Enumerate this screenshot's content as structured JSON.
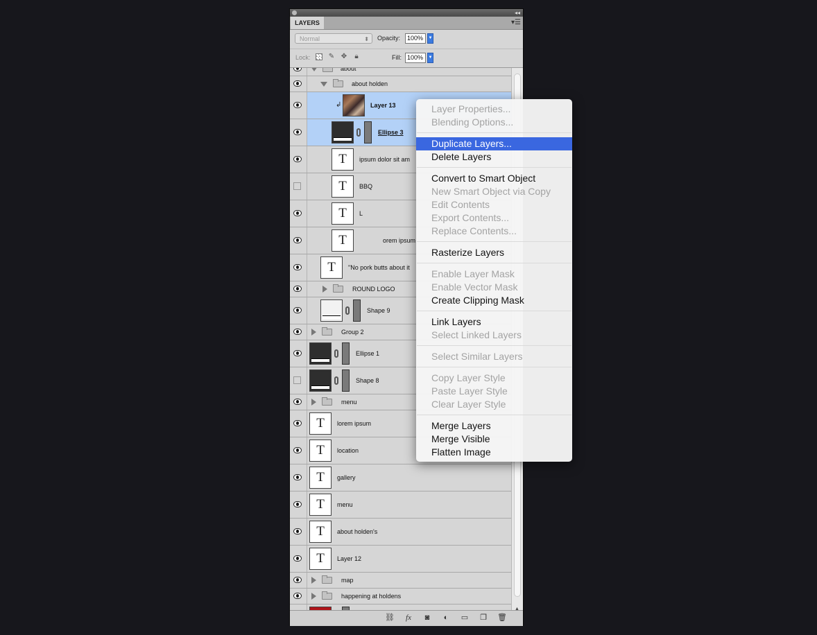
{
  "panel": {
    "tab_label": "LAYERS",
    "blend_mode": "Normal",
    "opacity_label": "Opacity:",
    "opacity_value": "100%",
    "lock_label": "Lock:",
    "fill_label": "Fill:",
    "fill_value": "100%"
  },
  "layers": [
    {
      "name": "about",
      "kind": "group-open",
      "visible": true
    },
    {
      "name": "about holden",
      "kind": "group-open",
      "visible": true
    },
    {
      "name": "Layer 13",
      "kind": "image-clipped",
      "visible": true,
      "selected": true
    },
    {
      "name": "Ellipse 3",
      "kind": "shape",
      "visible": true,
      "selected": true
    },
    {
      "name": "ipsum dolor sit am",
      "kind": "text",
      "visible": true
    },
    {
      "name": "BBQ",
      "kind": "text",
      "visible": false
    },
    {
      "name": "L",
      "kind": "text",
      "visible": true
    },
    {
      "name": "orem ipsum",
      "kind": "text",
      "visible": true
    },
    {
      "name": "\"No pork butts about it",
      "kind": "text",
      "visible": true
    },
    {
      "name": "ROUND LOGO",
      "kind": "group-closed",
      "visible": true
    },
    {
      "name": "Shape 9",
      "kind": "shape-light",
      "visible": true
    },
    {
      "name": "Group 2",
      "kind": "group-closed",
      "visible": true
    },
    {
      "name": "Ellipse 1",
      "kind": "shape",
      "visible": true
    },
    {
      "name": "Shape 8",
      "kind": "shape",
      "visible": false
    },
    {
      "name": "menu",
      "kind": "group-closed",
      "visible": true
    },
    {
      "name": "lorem ipsum",
      "kind": "text",
      "visible": true
    },
    {
      "name": "location",
      "kind": "text",
      "visible": true
    },
    {
      "name": "gallery",
      "kind": "text",
      "visible": true
    },
    {
      "name": "menu",
      "kind": "text",
      "visible": true
    },
    {
      "name": "about holden's",
      "kind": "text",
      "visible": true
    },
    {
      "name": "Layer 12",
      "kind": "text",
      "visible": true
    },
    {
      "name": "map",
      "kind": "group-closed",
      "visible": true
    },
    {
      "name": "happening at holdens",
      "kind": "group-closed",
      "visible": true
    },
    {
      "name": "",
      "kind": "shape-red",
      "visible": true
    }
  ],
  "context_menu": {
    "items": [
      {
        "label": "Layer Properties...",
        "enabled": false
      },
      {
        "label": "Blending Options...",
        "enabled": false
      },
      {
        "sep": true
      },
      {
        "label": "Duplicate Layers...",
        "enabled": true,
        "highlighted": true
      },
      {
        "label": "Delete Layers",
        "enabled": true
      },
      {
        "sep": true
      },
      {
        "label": "Convert to Smart Object",
        "enabled": true
      },
      {
        "label": "New Smart Object via Copy",
        "enabled": false
      },
      {
        "label": "Edit Contents",
        "enabled": false
      },
      {
        "label": "Export Contents...",
        "enabled": false
      },
      {
        "label": "Replace Contents...",
        "enabled": false
      },
      {
        "sep": true
      },
      {
        "label": "Rasterize Layers",
        "enabled": true
      },
      {
        "sep": true
      },
      {
        "label": "Enable Layer Mask",
        "enabled": false
      },
      {
        "label": "Enable Vector Mask",
        "enabled": false
      },
      {
        "label": "Create Clipping Mask",
        "enabled": true
      },
      {
        "sep": true
      },
      {
        "label": "Link Layers",
        "enabled": true
      },
      {
        "label": "Select Linked Layers",
        "enabled": false
      },
      {
        "sep": true
      },
      {
        "label": "Select Similar Layers",
        "enabled": false
      },
      {
        "sep": true
      },
      {
        "label": "Copy Layer Style",
        "enabled": false
      },
      {
        "label": "Paste Layer Style",
        "enabled": false
      },
      {
        "label": "Clear Layer Style",
        "enabled": false
      },
      {
        "sep": true
      },
      {
        "label": "Merge Layers",
        "enabled": true
      },
      {
        "label": "Merge Visible",
        "enabled": true
      },
      {
        "label": "Flatten Image",
        "enabled": true
      }
    ]
  },
  "bottom_icons": [
    "link-icon",
    "fx-icon",
    "mask-icon",
    "adjustment-icon",
    "new-group-icon",
    "new-layer-icon",
    "trash-icon"
  ],
  "colors": {
    "selection": "#b3d1f7",
    "menu_highlight": "#3a67e0",
    "background": "#17171c"
  }
}
